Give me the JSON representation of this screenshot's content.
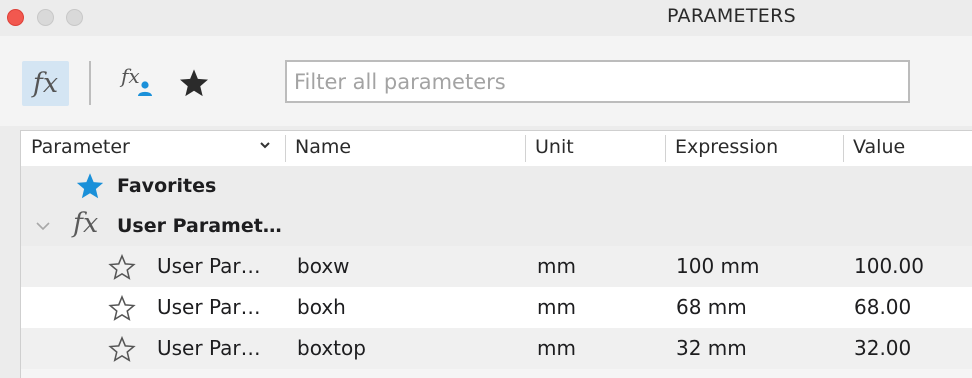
{
  "window": {
    "title": "PARAMETERS"
  },
  "toolbar": {
    "fx_glyph": "fx",
    "fx_user_glyph": "fx",
    "filter_placeholder": "Filter all parameters",
    "filter_value": ""
  },
  "colors": {
    "accent": "#1a90d9",
    "selected_bg": "#d4e5f3",
    "close": "#f2584f"
  },
  "table": {
    "columns": [
      "Parameter",
      "Name",
      "Unit",
      "Expression",
      "Value"
    ],
    "groups": [
      {
        "label": "Favorites",
        "icon": "star-filled-icon"
      },
      {
        "label": "User Paramet…",
        "icon": "fx-icon",
        "expanded": true
      }
    ],
    "rows": [
      {
        "parameter": "User Par…",
        "name": "boxw",
        "unit": "mm",
        "expression": "100 mm",
        "value": "100.00",
        "favorite": false
      },
      {
        "parameter": "User Par…",
        "name": "boxh",
        "unit": "mm",
        "expression": "68 mm",
        "value": "68.00",
        "favorite": false
      },
      {
        "parameter": "User Par…",
        "name": "boxtop",
        "unit": "mm",
        "expression": "32 mm",
        "value": "32.00",
        "favorite": false
      }
    ]
  }
}
